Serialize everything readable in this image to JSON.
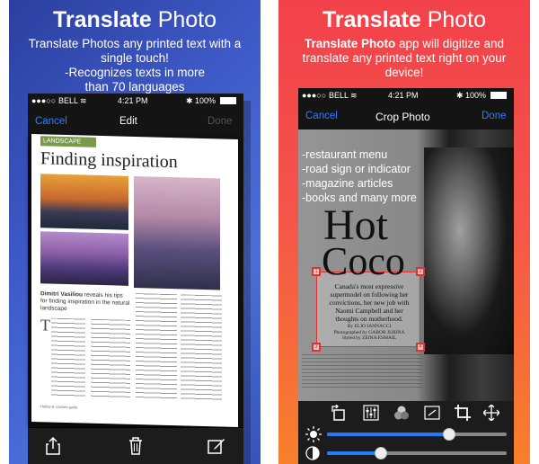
{
  "left": {
    "headline_bold": "Translate",
    "headline_rest": " Photo",
    "desc_line1": "Translate Photos any printed text with a",
    "desc_line2": "single touch!",
    "desc_line3": "-Recognizes texts in more",
    "desc_line4": "than 70 languages",
    "status": {
      "carrier": "BELL",
      "time": "4:21 PM",
      "battery": "100%"
    },
    "nav": {
      "cancel": "Cancel",
      "title": "Edit",
      "done": "Done"
    },
    "magazine": {
      "section": "LANDSCAPE",
      "title": "Finding inspiration",
      "author": "Dimitri Vasiliou",
      "lede_rest": " reveals his tips for finding inspiration in the natural landscape",
      "dropcap": "T",
      "footer": "Hobby & courses guide"
    },
    "toolbar": [
      "share-icon",
      "trash-icon",
      "edit-icon"
    ]
  },
  "right": {
    "headline_bold": "Translate",
    "headline_rest": " Photo",
    "desc_bold": "Translate Photo",
    "desc_rest": " app will digitize and translate any printed text right on your device!",
    "status": {
      "carrier": "BELL",
      "time": "4:21 PM",
      "battery": "100%"
    },
    "nav": {
      "cancel": "Cancel",
      "title": "Crop Photo",
      "done": "Done"
    },
    "bullets": [
      "-restaurant menu",
      "-road sign or indicator",
      "-magazine articles",
      "-books and many more"
    ],
    "cover": {
      "title1": "Hot",
      "title2": "Coco",
      "caption": [
        "Canada's most expressive",
        "supermodel on following her",
        "convictions, her new job with",
        "Naomi Campbell and her",
        "thoughts on motherhood."
      ],
      "credit": [
        "By ELIO IANNACCI",
        "Photographed by GABOR JURINA",
        "Styled by ZEINA ESMAIL"
      ]
    },
    "handles": [
      "1",
      "2",
      "3",
      "4"
    ],
    "tools": [
      "rotate-icon",
      "sliders-icon",
      "color-circles-icon",
      "aspect-icon",
      "crop-icon",
      "move-icon"
    ],
    "sliders": [
      {
        "name": "brightness",
        "value": 0.68
      },
      {
        "name": "contrast",
        "value": 0.3
      }
    ]
  }
}
